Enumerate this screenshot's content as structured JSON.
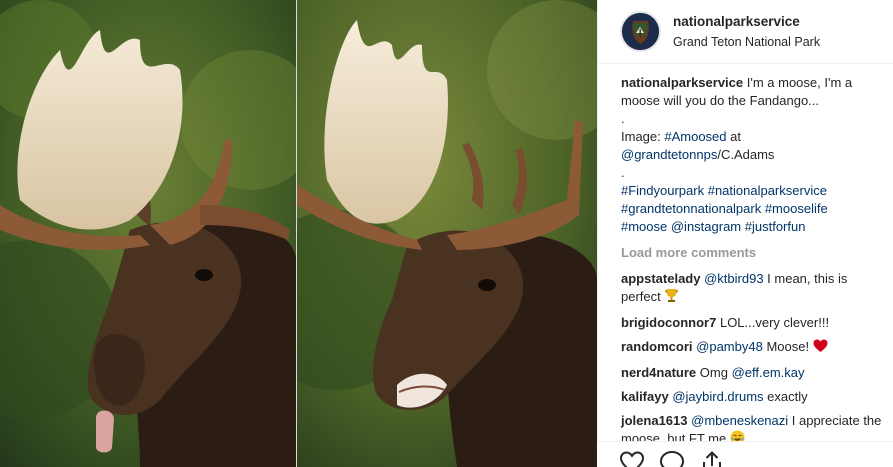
{
  "post": {
    "username": "nationalparkservice",
    "location": "Grand Teton National Park"
  },
  "caption": {
    "username": "nationalparkservice",
    "text": "I'm a moose, I'm a moose will you do the Fandango...",
    "dot1": ".",
    "image_prefix": "Image: ",
    "image_tag": "#Amoosed",
    "at_word": " at",
    "credit_handle": "@grandtetonnps",
    "credit_suffix": "/C.Adams",
    "dot2": ".",
    "hashtags_line1": "#Findyourpark #nationalparkservice",
    "hashtags_line2": "#grandtetonnationalpark #mooselife",
    "hashtags_line3": "#moose @instagram #justforfun"
  },
  "load_more": "Load more comments",
  "comments": [
    {
      "user": "appstatelady",
      "mention": "@ktbird93",
      "text": " I mean, this is perfect ",
      "emoji": "trophy-icon"
    },
    {
      "user": "brigidoconnor7",
      "mention": "",
      "text": "LOL...very clever!!!",
      "emoji": ""
    },
    {
      "user": "randomcori",
      "mention": "@pamby48",
      "text": " Moose! ",
      "emoji": "heart-icon"
    },
    {
      "user": "nerd4nature",
      "mention": "",
      "text": "Omg ",
      "mention_after": "@eff.em.kay",
      "emoji": ""
    },
    {
      "user": "kalifayy",
      "mention": "@jaybird.drums",
      "text": " exactly",
      "emoji": ""
    },
    {
      "user": "jolena1613",
      "mention": "@mbeneskenazi",
      "text": " I appreciate the moose, but FT me ",
      "emoji": "crying-laughing-icon"
    }
  ],
  "colors": {
    "link": "#003569",
    "muted": "#999999",
    "heart": "#ed4956",
    "avatar_bg": "#1c2c4a"
  },
  "icons": [
    "heart-outline-icon",
    "comment-icon",
    "share-icon"
  ]
}
